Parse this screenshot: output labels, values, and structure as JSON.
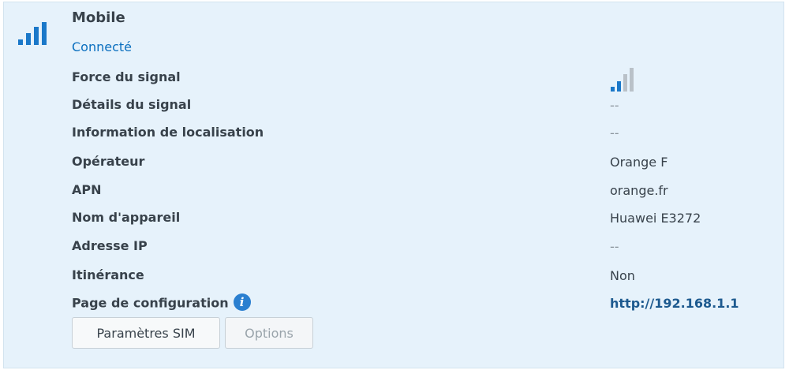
{
  "header": {
    "title": "Mobile",
    "status": "Connecté"
  },
  "rows": [
    {
      "label": "Force du signal",
      "value": ""
    },
    {
      "label": "Détails du signal",
      "value": "--"
    },
    {
      "label": "Information de localisation",
      "value": "--"
    },
    {
      "label": "Opérateur",
      "value": "Orange F"
    },
    {
      "label": "APN",
      "value": "orange.fr"
    },
    {
      "label": "Nom d'appareil",
      "value": "Huawei E3272"
    },
    {
      "label": "Adresse IP",
      "value": "--"
    },
    {
      "label": "Itinérance",
      "value": "Non"
    },
    {
      "label": "Page de configuration",
      "value": "http://192.168.1.1"
    }
  ],
  "signal_strength_bars": 2,
  "signal_strength_total_bars": 4,
  "buttons": {
    "sim_settings": "Paramètres SIM",
    "options": "Options"
  },
  "colors": {
    "panel_background": "#e6f2fb",
    "accent": "#0a6fbf",
    "link": "#1d5a8f",
    "signal_active": "#1a78c9",
    "signal_inactive": "#b9c1c8"
  }
}
